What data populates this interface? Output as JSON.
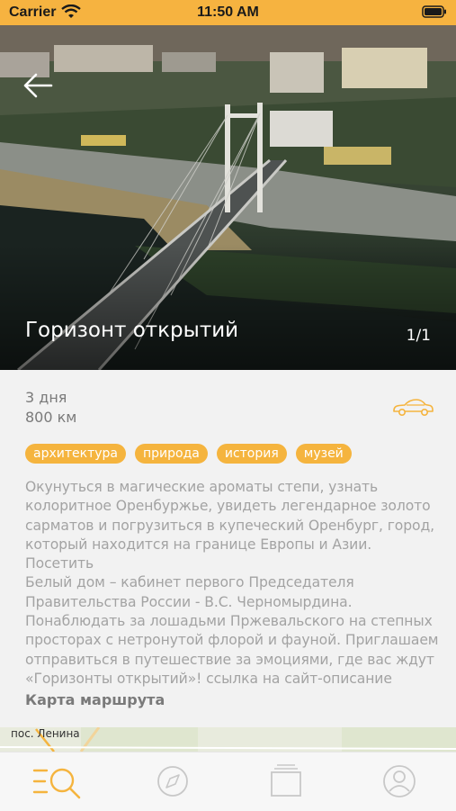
{
  "status_bar": {
    "carrier": "Carrier",
    "time": "11:50 AM",
    "wifi_icon": "wifi-icon",
    "battery_icon": "battery-icon"
  },
  "header": {
    "back_icon": "arrow-left-icon"
  },
  "tour": {
    "title": "Горизонт открытий",
    "photo_counter": "1/1",
    "duration": "3 дня",
    "distance": "800 км",
    "transport_icon": "car-icon",
    "tags": [
      "архитектура",
      "природа",
      "история",
      "музей"
    ],
    "description": [
      "Окунуться в магические ароматы степи, узнать",
      "колоритное Оренбуржье, увидеть легендарное золото",
      "сарматов и погрузиться в купеческий Оренбург, город,",
      "который находится на границе Европы и Азии.  Посетить",
      "Белый дом – кабинет первого Председателя",
      "Правительства России - В.С. Черномырдина.",
      "Понаблюдать за лошадьми Пржевальского на степных",
      "просторах с  нетронутой флорой и фауной. Приглашаем",
      "отправиться в путешествие за эмоциями, где вас ждут",
      "«Горизонты открытий»! ссылка на сайт-описание"
    ],
    "map_section_label": "Карта маршрута",
    "map_place_label": "пос. Ленина"
  },
  "tab_bar": {
    "tabs": [
      {
        "icon": "search-list-icon",
        "active": true
      },
      {
        "icon": "compass-icon",
        "active": false
      },
      {
        "icon": "cards-icon",
        "active": false
      },
      {
        "icon": "profile-icon",
        "active": false
      }
    ]
  },
  "colors": {
    "accent": "#f5b43e",
    "status_bar": "#f6b340",
    "text_secondary": "#7a7a7a",
    "text_body": "#a3a3a3",
    "inactive_tab": "#c8c8c8"
  }
}
